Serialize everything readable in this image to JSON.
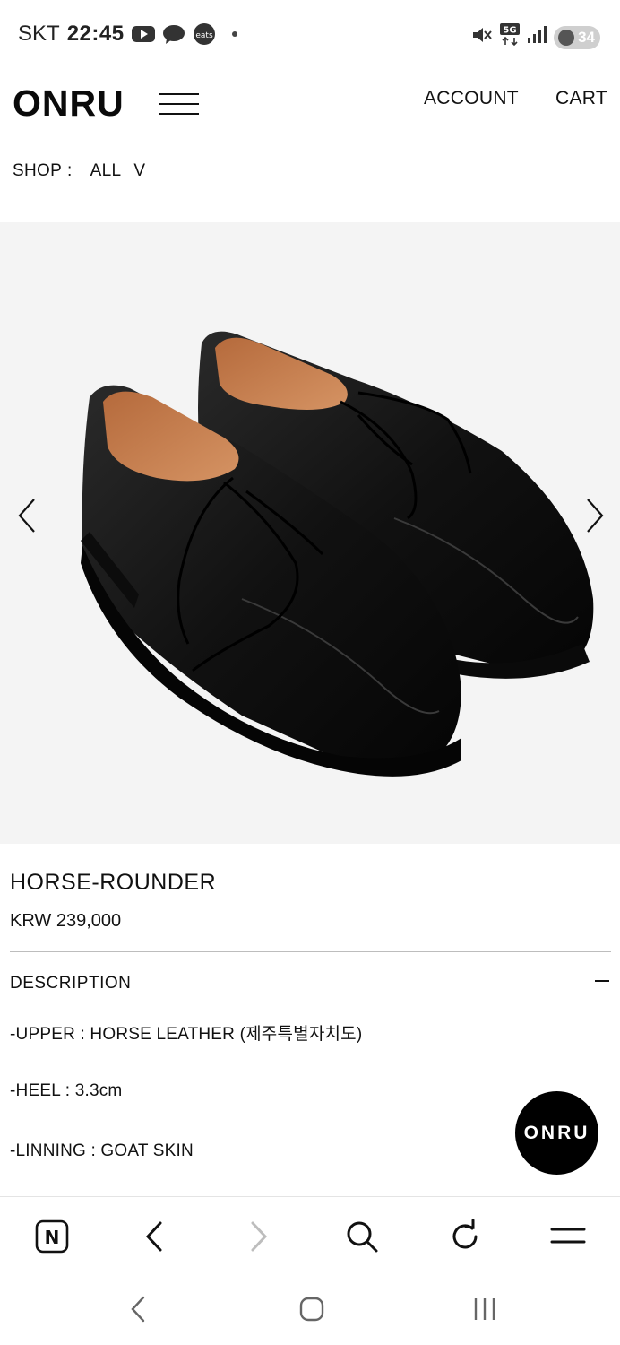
{
  "status_bar": {
    "carrier": "SKT",
    "time": "22:45",
    "app_icons": [
      "youtube-icon",
      "chat-bubble-icon",
      "coupang-eats-icon"
    ],
    "eats_label": "eats",
    "network": "5G",
    "battery": "34"
  },
  "header": {
    "logo": "ONRU",
    "account": "ACCOUNT",
    "cart": "CART"
  },
  "shop_filter": {
    "label": "SHOP",
    "separator": ":",
    "selected": "ALL",
    "chevron": "V"
  },
  "product": {
    "title": "HORSE-ROUNDER",
    "price": "KRW 239,000",
    "image_desc_icon": "black-leather-derby-shoes",
    "description_header": "DESCRIPTION",
    "specs": [
      "-UPPER : HORSE LEATHER (제주특별자치도)",
      "-HEEL : 3.3cm",
      "-LINNING : GOAT SKIN"
    ]
  },
  "floating_badge": {
    "label": "ONRU"
  },
  "browser_toolbar": {
    "home_label": "N",
    "items": [
      "naver-home-icon",
      "back-icon",
      "forward-icon",
      "search-icon",
      "refresh-icon",
      "menu-icon"
    ]
  },
  "nav_bar": {
    "items": [
      "back-icon",
      "home-icon",
      "recents-icon"
    ]
  },
  "colors": {
    "text": "#111111",
    "image_bg": "#f4f4f4",
    "badge_bg": "#000000",
    "disabled": "#bdbdbd"
  }
}
